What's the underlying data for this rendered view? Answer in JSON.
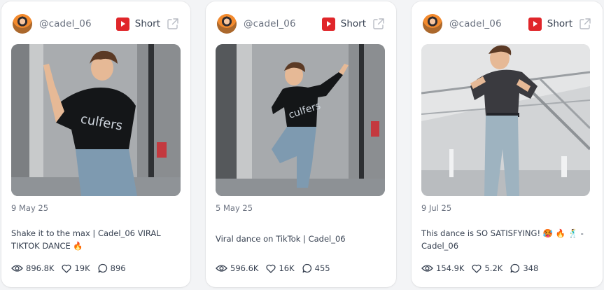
{
  "cards": [
    {
      "handle": "@cadel_06",
      "platform_icon": "youtube-icon",
      "type": "Short",
      "date": "9 May 25",
      "title": "Shake it to the max | Cadel_06 VIRAL TIKTOK DANCE 🔥",
      "views": "896.8K",
      "likes": "19K",
      "comments": "896"
    },
    {
      "handle": "@cadel_06",
      "platform_icon": "youtube-icon",
      "type": "Short",
      "date": "5 May 25",
      "title": "Viral dance on TikTok | Cadel_06",
      "views": "596.6K",
      "likes": "16K",
      "comments": "455"
    },
    {
      "handle": "@cadel_06",
      "platform_icon": "youtube-icon",
      "type": "Short",
      "date": "9 Jul 25",
      "title": "This dance is SO SATISFYING! 🥵 🔥 🕺 - Cadel_06",
      "views": "154.9K",
      "likes": "5.2K",
      "comments": "348"
    }
  ],
  "colors": {
    "youtube_red": "#e0262a",
    "text_muted": "#6b7280",
    "text_main": "#374151"
  }
}
